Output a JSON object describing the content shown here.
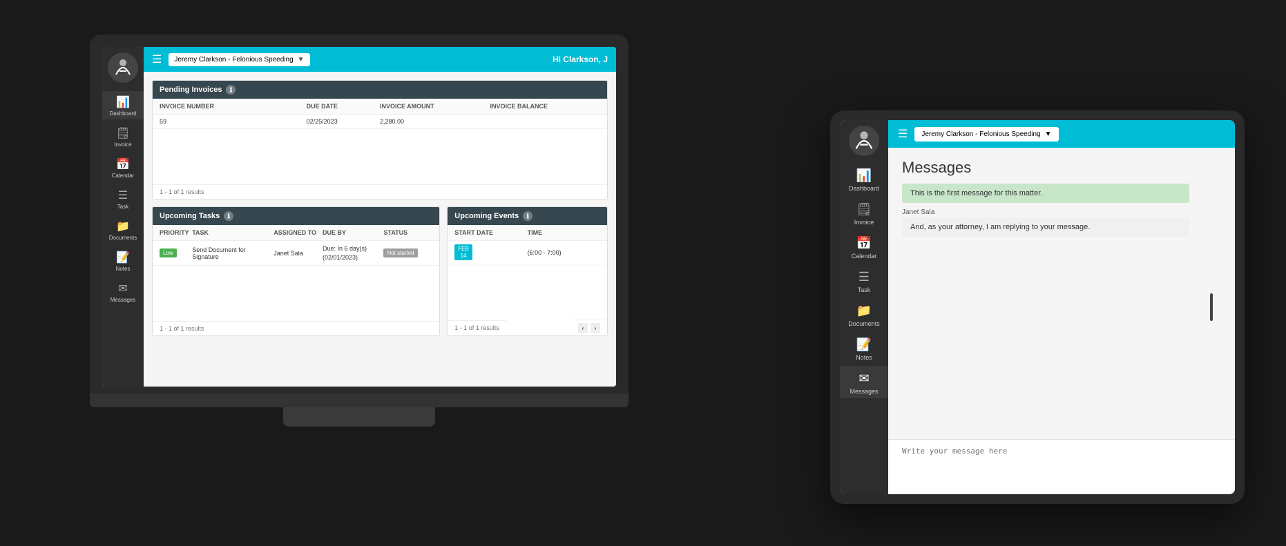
{
  "laptop": {
    "header": {
      "menu_icon": "☰",
      "dropdown_text": "Jeremy Clarkson - Felonious Speeding",
      "greeting": "Hi Clarkson, J"
    },
    "sidebar": {
      "items": [
        {
          "label": "Dashboard",
          "icon": "📊"
        },
        {
          "label": "Invoice",
          "icon": "🗒"
        },
        {
          "label": "Calendar",
          "icon": "📅"
        },
        {
          "label": "Task",
          "icon": "☰"
        },
        {
          "label": "Documents",
          "icon": "📁"
        },
        {
          "label": "Notes",
          "icon": "📝"
        },
        {
          "label": "Messages",
          "icon": "✉"
        }
      ]
    },
    "pending_invoices": {
      "title": "Pending Invoices",
      "columns": [
        "INVOICE NUMBER",
        "DUE DATE",
        "INVOICE AMOUNT",
        "INVOICE BALANCE"
      ],
      "rows": [
        [
          "59",
          "02/25/2023",
          "2,280.00",
          ""
        ]
      ],
      "result_count": "1 - 1 of 1 results"
    },
    "upcoming_tasks": {
      "title": "Upcoming Tasks",
      "columns": [
        "PRIORITY",
        "TASK",
        "ASSIGNED TO",
        "DUE BY",
        "STATUS"
      ],
      "rows": [
        {
          "priority": "Low",
          "task": "Send Document for Signature",
          "assigned_to": "Janet Sala",
          "due_by": "Due: In 6 day(s)\n(02/01/2023)",
          "status": "Not started"
        }
      ],
      "result_count": "1 - 1 of 1 results"
    },
    "upcoming_events": {
      "title": "Upcoming Events",
      "columns": [
        "START DATE",
        "TIME"
      ],
      "rows": [
        {
          "date": "FEB\n14",
          "time": "(6:00 - 7:00)"
        }
      ],
      "result_count": "1 - 1 of 1 results"
    }
  },
  "tablet": {
    "header": {
      "menu_icon": "☰",
      "dropdown_text": "Jeremy Clarkson - Felonious Speeding"
    },
    "sidebar": {
      "items": [
        {
          "label": "Dashboard",
          "icon": "📊"
        },
        {
          "label": "Invoice",
          "icon": "🗒"
        },
        {
          "label": "Calendar",
          "icon": "📅"
        },
        {
          "label": "Task",
          "icon": "☰"
        },
        {
          "label": "Documents",
          "icon": "📁"
        },
        {
          "label": "Notes",
          "icon": "📝"
        },
        {
          "label": "Messages",
          "icon": "✉",
          "active": true
        }
      ]
    },
    "messages_page": {
      "title": "Messages",
      "messages": [
        {
          "type": "green",
          "text": "This is the first message for this matter."
        },
        {
          "type": "gray",
          "sender": "Janet Sala",
          "text": "And, as your attorney, I am replying to your message."
        }
      ],
      "input_placeholder": "Write your message here"
    }
  }
}
